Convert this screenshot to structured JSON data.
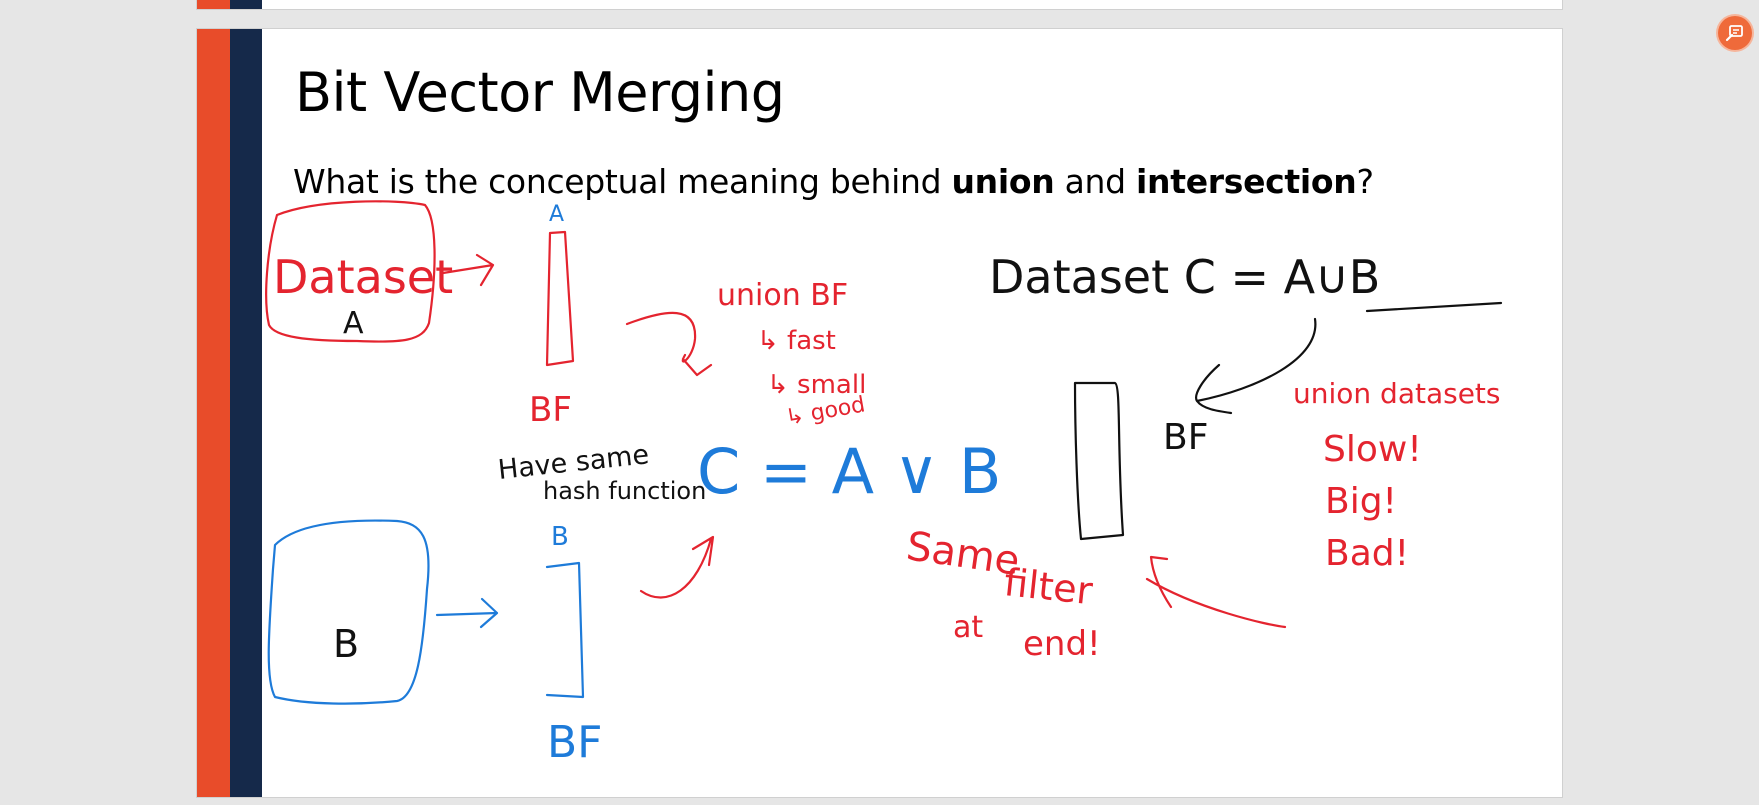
{
  "slide": {
    "title": "Bit Vector Merging",
    "subtitle": {
      "part1": "What is the conceptual meaning behind ",
      "bold1": "union",
      "part2": " and ",
      "bold2": "intersection",
      "part3": "?"
    }
  },
  "annotations": {
    "dataset_label": "Dataset",
    "dataset_a_letter": "A",
    "bf_a_top_letter": "A",
    "bf_a_label": "BF",
    "have_same": "Have same",
    "hash_function": "hash function",
    "bf_b_top_letter": "B",
    "dataset_b_letter": "B",
    "bf_b_label": "BF",
    "union_bf": "union BF",
    "fast": "↳ fast",
    "small": "↳ small",
    "good": "↳ good",
    "c_equals_a_or_b": "C = A ∨ B",
    "dataset_c": "Dataset  C = A∪B",
    "bf_c_label": "BF",
    "union_datasets": "union  datasets",
    "slow": "Slow!",
    "big": "Big!",
    "bad": "Bad!",
    "same_filter_1": "Same",
    "same_filter_2": "filter",
    "same_filter_3": "at",
    "same_filter_4": "end!"
  },
  "colors": {
    "accent_orange": "#e84c2a",
    "accent_navy": "#15294a",
    "ink_red": "#e4242f",
    "ink_blue": "#1e7bd9",
    "ink_black": "#111111",
    "pen_button": "#ef6a3a"
  },
  "icons": {
    "pen_tool": "annotate-pen-icon"
  }
}
